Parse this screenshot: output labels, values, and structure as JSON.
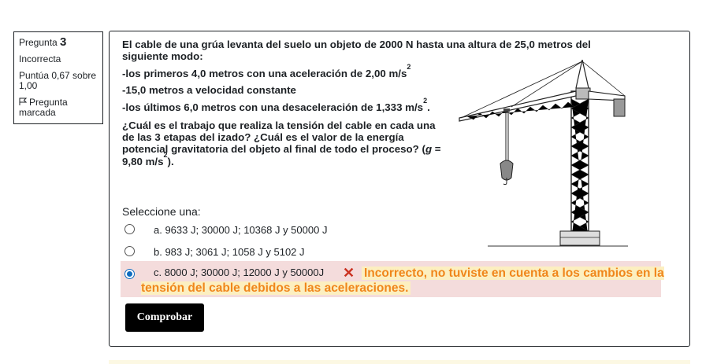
{
  "info": {
    "question_prefix": "Pregunta",
    "question_number": "3",
    "state": "Incorrecta",
    "grade": "Puntúa 0,67 sobre 1,00",
    "flag_label": "Pregunta marcada"
  },
  "question": {
    "line1": "El cable de una grúa levanta del suelo un objeto de 2000 N hasta una altura de 25,0 metros del siguiente modo:",
    "stage1": "-los primeros 4,0 metros con una aceleración de 2,00 m/s",
    "stage1_sup": "2",
    "stage2": "-15,0 metros a velocidad constante",
    "stage3": "-los últimos 6,0 metros con una desaceleración de 1,333 m/s",
    "stage3_sup": "2",
    "stage3_end": ".",
    "ask": "¿Cuál es el trabajo que realiza la tensión del cable en cada una de las 3 etapas del izado? ¿Cuál es el valor de la energía potencial gravitatoria del objeto al final de todo el proceso? (",
    "ask_g": "g",
    "ask_tail": " = 9,80 m/s",
    "ask_sup": "2",
    "ask_end": ")."
  },
  "answer": {
    "select_label": "Seleccione una:",
    "options": [
      {
        "label": "a. 9633 J; 30000 J; 10368 J y  50000 J",
        "checked": false
      },
      {
        "label": "b. 983 J; 3061 J; 1058 J y 5102 J",
        "checked": false
      },
      {
        "label": "c. 8000 J; 30000 J; 12000 J y 50000J",
        "checked": true
      }
    ],
    "feedback": "Incorrecto, no tuviste en cuenta a los cambios en la tensión del cable debidos a las aceleraciones."
  },
  "check_button": "Comprobar",
  "colors": {
    "accent": "#0f6cbf",
    "incorrect": "#ca3120",
    "feedback": "#f0861b",
    "selected_bg": "#f4dcdc"
  }
}
